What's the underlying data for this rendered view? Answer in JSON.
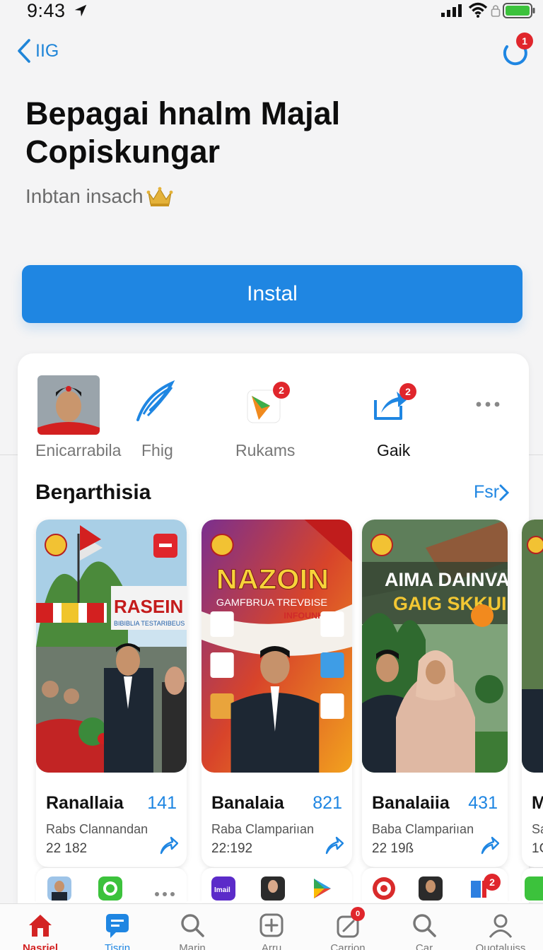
{
  "status_bar": {
    "time": "9:43"
  },
  "nav": {
    "back_label": "IIG",
    "notification_count": "1"
  },
  "app": {
    "title": "Bepagai hnalm Majal Copiskungar",
    "subtitle": "Inbtan insach"
  },
  "install": {
    "label": "Instal"
  },
  "quick_actions": [
    {
      "label": "Enicarrabila",
      "icon": "profile-photo"
    },
    {
      "label": "Fhig",
      "icon": "feather-icon"
    },
    {
      "label": "Rukams",
      "icon": "forward-arrow-icon",
      "badge": "2"
    },
    {
      "label": "Gaik",
      "icon": "share-box-icon",
      "badge": "2"
    },
    {
      "label": "",
      "icon": "more-icon"
    }
  ],
  "section": {
    "title": "Beŋarthisia",
    "link": "Fsr"
  },
  "tiles": [
    {
      "banner": "RASEIN",
      "banner_sub": "BIBIBLIA TESTARIBEUS",
      "name": "Ranallaia",
      "count": "141",
      "sub": "Rabs Clannandan",
      "num": "22 182"
    },
    {
      "banner": "NAZOIN",
      "banner_sub": "GAMFBRUA TREVBISE",
      "banner_sub2": "INFOUNKE",
      "name": "Banalaia",
      "count": "821",
      "sub": "Raba Clampariıan",
      "num": "22:192"
    },
    {
      "banner": "AIMA DAINVA",
      "banner_sub": "GAIG SKKUIN",
      "name": "Banalaiia",
      "count": "431",
      "sub": "Baba Clampariıan",
      "num": "22 19ß"
    },
    {
      "name": "M",
      "sub": "Sa",
      "num": "1C"
    }
  ],
  "mini_tiles": [
    {
      "icons": [
        "avatar",
        "messages",
        "more"
      ]
    },
    {
      "icons": [
        "imail",
        "portrait",
        "play"
      ]
    },
    {
      "icons": [
        "target",
        "portrait",
        "pages"
      ],
      "badge": "2"
    }
  ],
  "tabs": [
    {
      "label": "Nasriel",
      "icon": "home-icon"
    },
    {
      "label": "Tisrin",
      "icon": "chat-icon"
    },
    {
      "label": "Marin",
      "icon": "search-icon"
    },
    {
      "label": "Arru",
      "icon": "add-icon"
    },
    {
      "label": "Carrion",
      "icon": "compose-icon",
      "badge": "0"
    },
    {
      "label": "Car",
      "icon": "search-icon"
    },
    {
      "label": "Quotaluiss",
      "icon": "profile-icon"
    }
  ],
  "colors": {
    "accent": "#1f86e2",
    "badge": "#e0262c",
    "active_tab": "#d32323"
  }
}
